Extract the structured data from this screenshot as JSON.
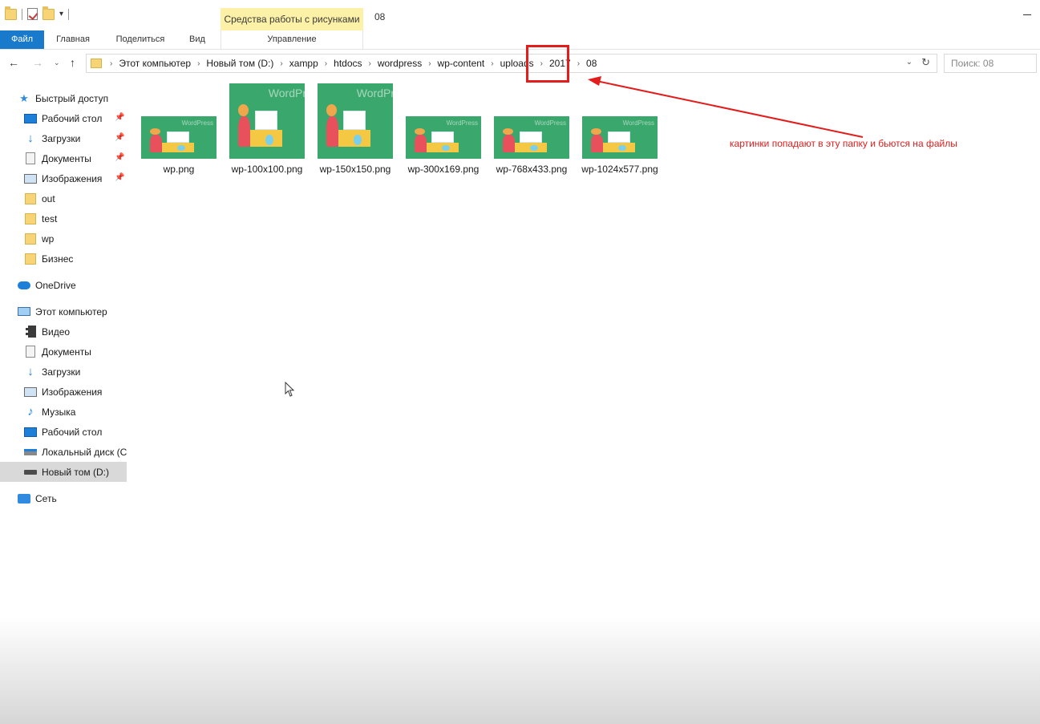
{
  "titlebar": {
    "context_tab": "Средства работы с рисунками",
    "window_title": "08"
  },
  "ribbon": {
    "tabs": [
      "Файл",
      "Главная",
      "Поделиться",
      "Вид"
    ],
    "context_tab_label": "Управление",
    "accent": "#1979ca"
  },
  "address": {
    "crumbs": [
      "Этот компьютер",
      "Новый том (D:)",
      "xampp",
      "htdocs",
      "wordpress",
      "wp-content",
      "uploads",
      "2017",
      "08"
    ],
    "search_placeholder": "Поиск: 08"
  },
  "annotation": {
    "text": "картинки попадают в эту папку и бьются на файлы",
    "color": "#e31c1c"
  },
  "sidebar": {
    "quick_access": {
      "label": "Быстрый доступ",
      "items": [
        "Рабочий стол",
        "Загрузки",
        "Документы",
        "Изображения",
        "out",
        "test",
        "wp",
        "Бизнес"
      ]
    },
    "onedrive": "OneDrive",
    "this_pc": {
      "label": "Этот компьютер",
      "items": [
        "Видео",
        "Документы",
        "Загрузки",
        "Изображения",
        "Музыка",
        "Рабочий стол",
        "Локальный диск (C",
        "Новый том (D:)"
      ]
    },
    "network": "Сеть"
  },
  "files": [
    {
      "name": "wp.png",
      "watermark": "WordPress"
    },
    {
      "name": "wp-100x100.png",
      "watermark": "WordPr"
    },
    {
      "name": "wp-150x150.png",
      "watermark": "WordPr"
    },
    {
      "name": "wp-300x169.png",
      "watermark": "WordPress"
    },
    {
      "name": "wp-768x433.png",
      "watermark": "WordPress"
    },
    {
      "name": "wp-1024x577.png",
      "watermark": "WordPress"
    }
  ]
}
